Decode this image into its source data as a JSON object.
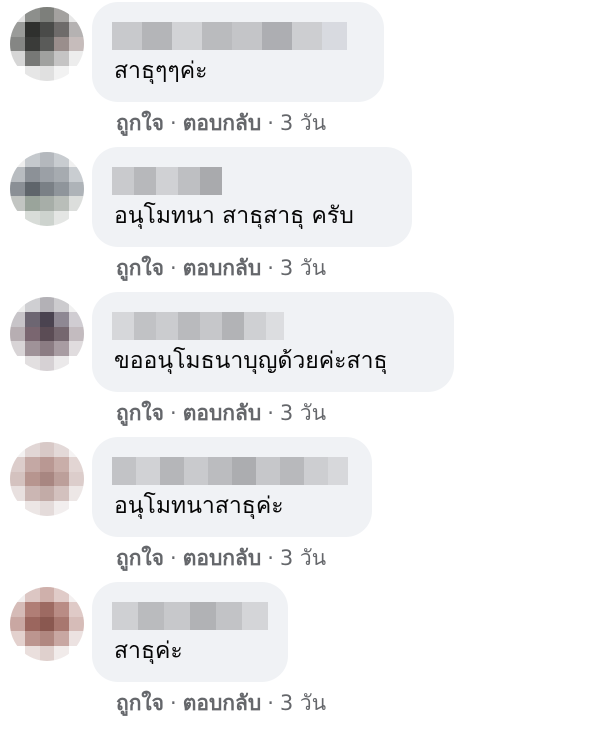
{
  "labels": {
    "like": "ถูกใจ",
    "reply": "ตอบกลับ",
    "separator": "·"
  },
  "comments": [
    {
      "text": "สาธุๆๆค่ะ",
      "time": "3 วัน"
    },
    {
      "text": "อนุโมทนา สาธุสาธุ ครับ",
      "time": "3 วัน"
    },
    {
      "text": "ขออนุโมธนาบุญด้วยค่ะสาธุ",
      "time": "3 วัน"
    },
    {
      "text": "อนุโมทนาสาธุค่ะ",
      "time": "3 วัน"
    },
    {
      "text": "สาธุค่ะ",
      "time": "3 วัน"
    }
  ],
  "colors": {
    "bubble": "#f0f2f5",
    "text": "#050505",
    "secondary": "#65676b"
  }
}
